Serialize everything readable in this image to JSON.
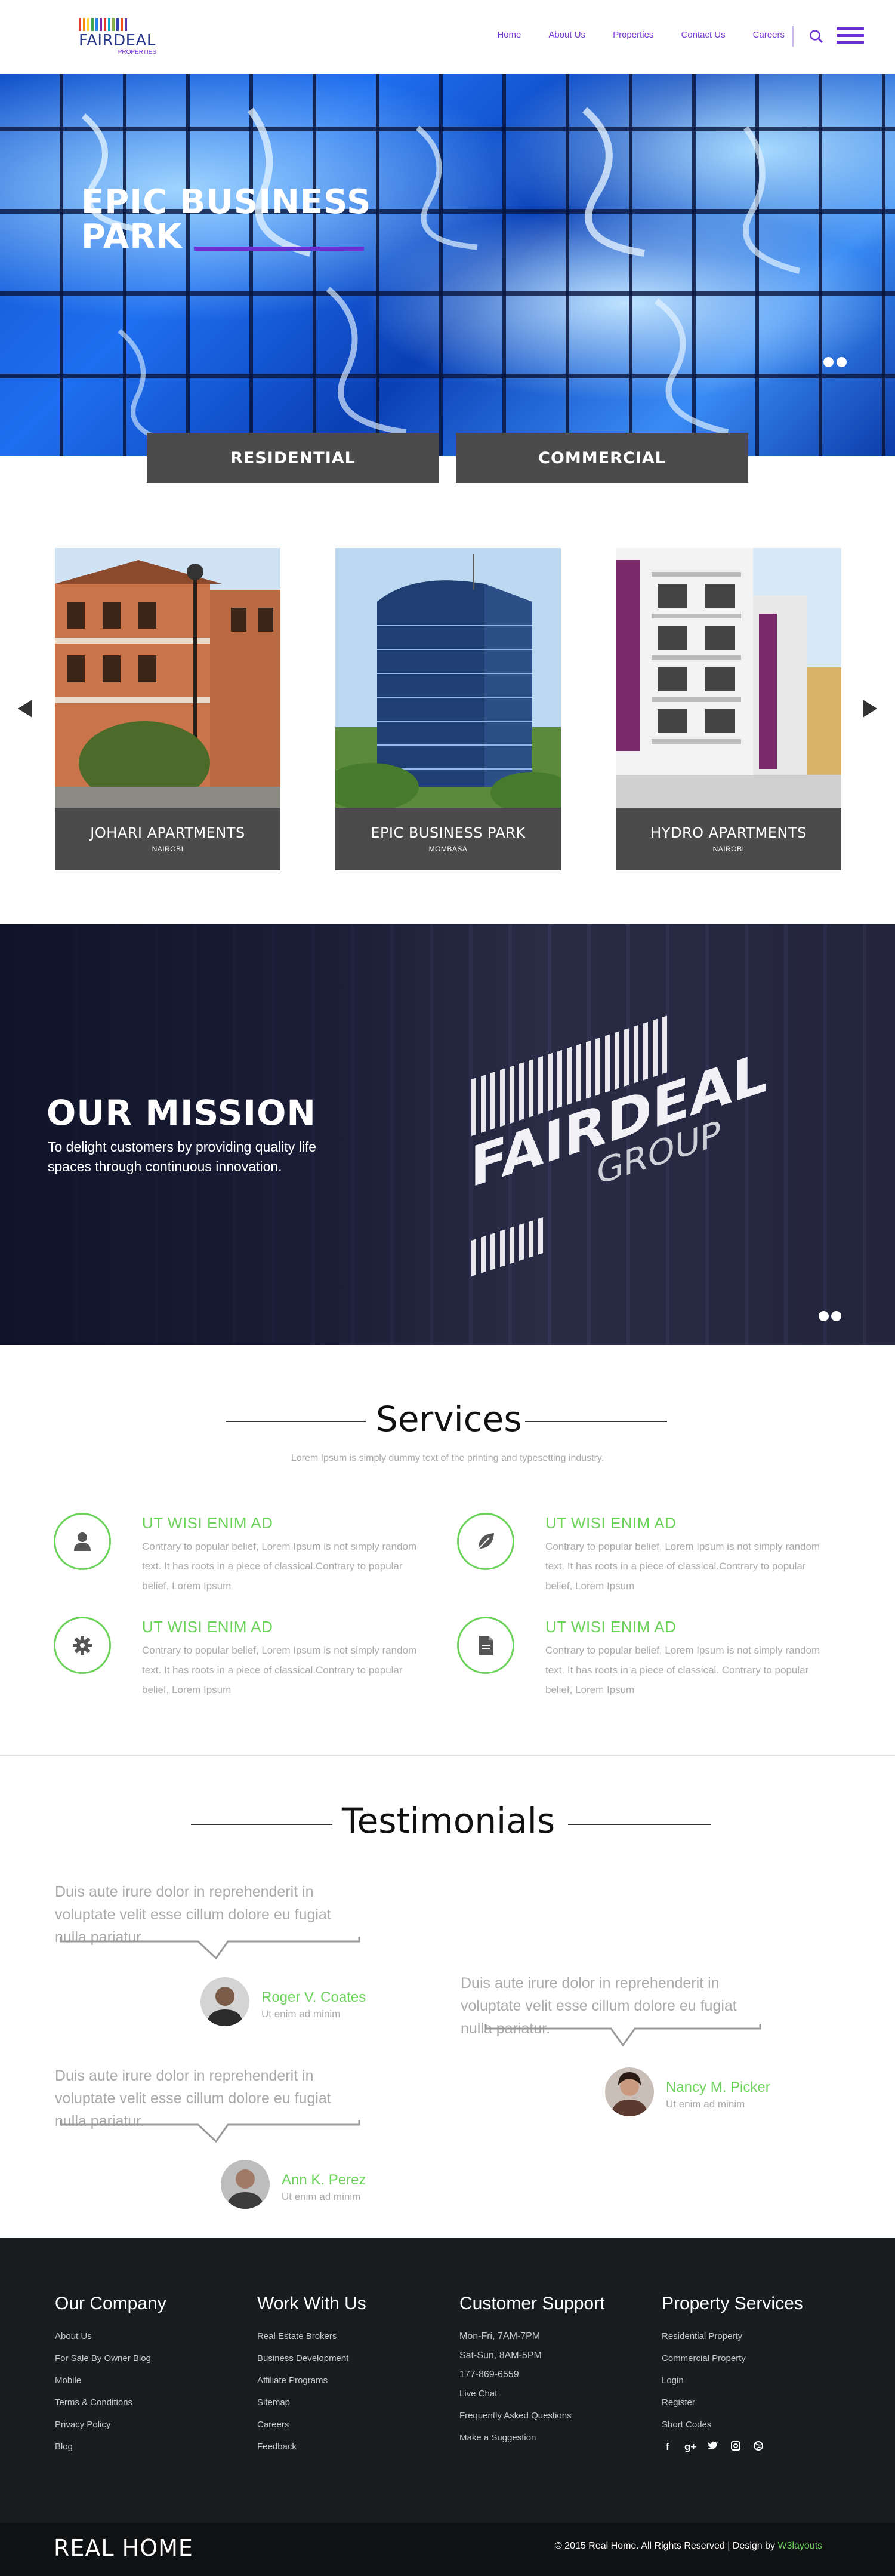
{
  "header": {
    "logo": {
      "word": "FAIRDEAL",
      "sub": "PROPERTIES",
      "bar_colors": [
        "#e53935",
        "#fb8c00",
        "#fdd835",
        "#43a047",
        "#1e88e5",
        "#8e24aa",
        "#e53935",
        "#00acc1",
        "#7cb342",
        "#3949ab",
        "#f4511e",
        "#5e35b1"
      ]
    },
    "nav": [
      "Home",
      "About Us",
      "Properties",
      "Contact Us",
      "Careers"
    ],
    "icons": {
      "search": "search-icon",
      "menu": "hamburger-menu-icon"
    }
  },
  "hero": {
    "title_line1": "EPIC BUSINESS",
    "title_line2": "PARK",
    "slide_count": 2
  },
  "tabs": {
    "residential": "RESIDENTIAL",
    "commercial": "COMMERCIAL"
  },
  "properties": [
    {
      "name": "JOHARI APARTMENTS",
      "city": "NAIROBI"
    },
    {
      "name": "EPIC BUSINESS PARK",
      "city": "MOMBASA"
    },
    {
      "name": "HYDRO APARTMENTS",
      "city": "NAIROBI"
    }
  ],
  "mission": {
    "title": "OUR MISSION",
    "text": "To delight customers by providing quality life spaces through continuous innovation.",
    "sign_main": "FAIRDEAL",
    "sign_sub": "GROUP"
  },
  "services": {
    "title": "Services",
    "subtitle": "Lorem Ipsum is simply dummy text of the printing and typesetting industry.",
    "items": [
      {
        "title": "UT WISI ENIM AD",
        "text": "Contrary to popular belief, Lorem Ipsum is not simply random text. It has roots in a piece of classical.Contrary to popular belief, Lorem Ipsum",
        "icon": "user-icon"
      },
      {
        "title": "UT WISI ENIM AD",
        "text": "Contrary to popular belief, Lorem Ipsum is not simply random text. It has roots in a piece of classical.Contrary to popular belief, Lorem Ipsum",
        "icon": "leaf-icon"
      },
      {
        "title": "UT WISI ENIM AD",
        "text": "Contrary to popular belief, Lorem Ipsum is not simply random text. It has roots in a piece of classical.Contrary to popular belief, Lorem Ipsum",
        "icon": "gear-icon"
      },
      {
        "title": "UT WISI ENIM AD",
        "text": "Contrary to popular belief, Lorem Ipsum is not simply random text. It has roots in a piece of classical. Contrary to popular belief, Lorem Ipsum",
        "icon": "document-icon"
      }
    ]
  },
  "testimonials": {
    "title": "Testimonials",
    "items": [
      {
        "quote": "Duis aute irure dolor in reprehenderit in voluptate velit esse cillum dolore eu fugiat nulla pariatur.",
        "name": "Roger V. Coates",
        "role": "Ut enim ad minim"
      },
      {
        "quote": "Duis aute irure dolor in reprehenderit in voluptate velit esse cillum dolore eu fugiat nulla pariatur.",
        "name": "Nancy M. Picker",
        "role": "Ut enim ad minim"
      },
      {
        "quote": "Duis aute irure dolor in reprehenderit in voluptate velit esse cillum dolore eu fugiat nulla pariatur.",
        "name": "Ann K. Perez",
        "role": "Ut enim ad minim"
      }
    ]
  },
  "footer": {
    "columns": [
      {
        "heading": "Our Company",
        "items": [
          "About Us",
          "For Sale By Owner Blog",
          "Mobile",
          "Terms & Conditions",
          "Privacy Policy",
          "Blog"
        ]
      },
      {
        "heading": "Work With Us",
        "items": [
          "Real Estate Brokers",
          "Business Development",
          "Affiliate Programs",
          "Sitemap",
          "Careers",
          "Feedback"
        ]
      },
      {
        "heading": "Customer Support",
        "items": [
          "Mon-Fri, 7AM-7PM",
          "Sat-Sun, 8AM-5PM",
          "177-869-6559",
          "Live Chat",
          "Frequently Asked Questions",
          "Make a Suggestion"
        ]
      },
      {
        "heading": "Property Services",
        "items": [
          "Residential Property",
          "Commercial Property",
          "Login",
          "Register",
          "Short Codes"
        ]
      }
    ],
    "socials": [
      "f",
      "g+",
      "t",
      "ig",
      "dr"
    ],
    "brand": "REAL HOME",
    "copyright": "© 2015 Real Home. All Rights Reserved | Design by ",
    "designer": "W3layouts"
  },
  "colors": {
    "accent": "#6a2fd0",
    "green": "#6cd35a",
    "dark": "#4b4b4b",
    "footer": "#1a1d1f"
  }
}
